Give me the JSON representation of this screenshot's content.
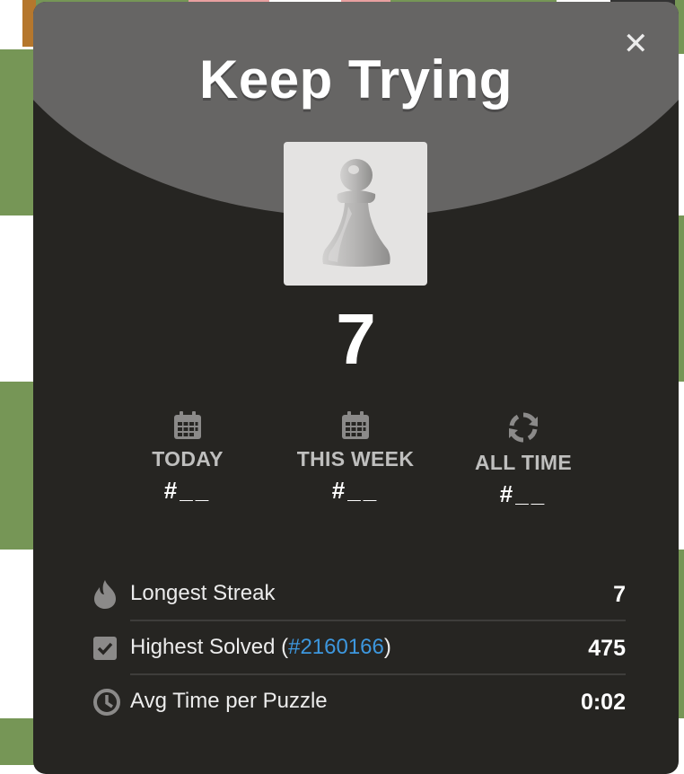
{
  "modal": {
    "title": "Keep Trying",
    "close_icon": "close-icon",
    "piece_icon": "pawn-icon",
    "score": "7"
  },
  "rankings": [
    {
      "icon": "calendar-icon",
      "label": "TODAY",
      "value": "#__"
    },
    {
      "icon": "calendar-icon",
      "label": "THIS WEEK",
      "value": "#__"
    },
    {
      "icon": "refresh-icon",
      "label": "ALL TIME",
      "value": "#__"
    }
  ],
  "stats": {
    "longest_streak": {
      "icon": "flame-icon",
      "label": "Longest Streak",
      "value": "7"
    },
    "highest_solved": {
      "icon": "checkbox-icon",
      "label_prefix": "Highest Solved (",
      "link": "#2160166",
      "label_suffix": ")",
      "value": "475"
    },
    "avg_time": {
      "icon": "clock-icon",
      "label": "Avg Time per Puzzle",
      "value": "0:02"
    }
  },
  "colors": {
    "modal_bg": "#262522",
    "header_bg": "#666564",
    "link": "#3d97de",
    "board_green": "#769656"
  }
}
